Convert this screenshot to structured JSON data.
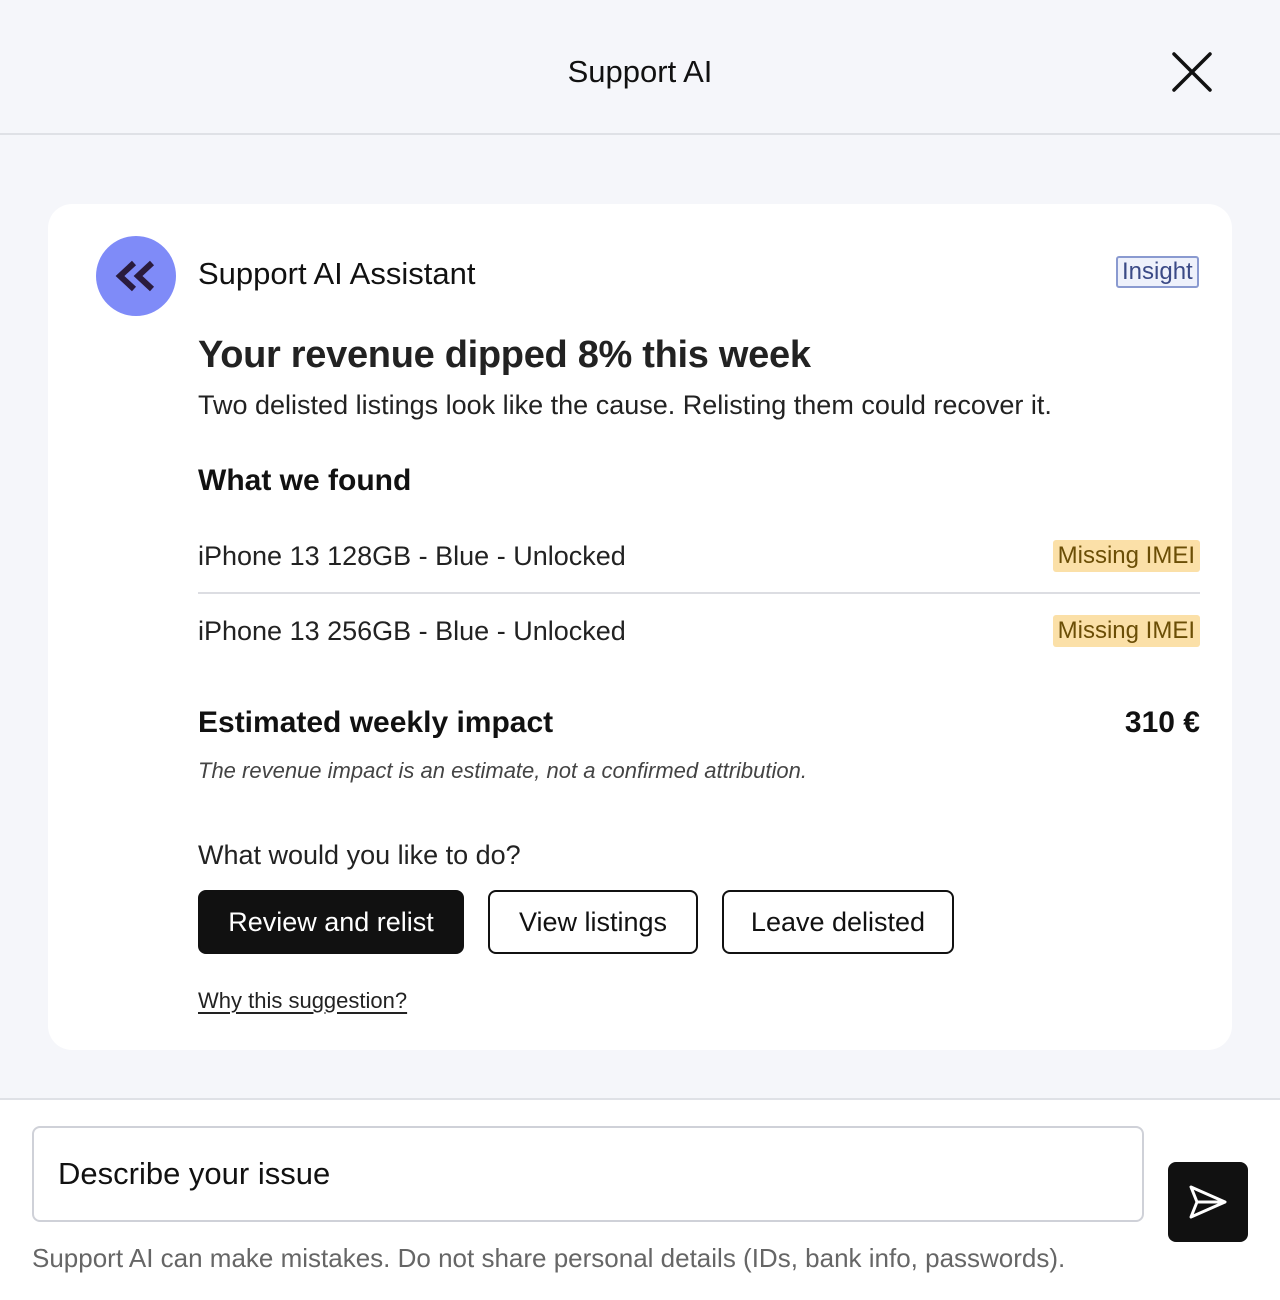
{
  "header": {
    "title": "Support AI",
    "close_icon": "close-icon"
  },
  "message": {
    "avatar_icon": "double-chevron-left-icon",
    "assistant_name": "Support AI Assistant",
    "badge": "Insight",
    "headline": "Your revenue dipped 8% this week",
    "subtext": "Two delisted listings look like the cause. Relisting them could recover it.",
    "findings_title": "What we found",
    "listings": [
      {
        "name": "iPhone 13 128GB - Blue - Unlocked",
        "status": "Missing IMEI"
      },
      {
        "name": "iPhone 13 256GB - Blue - Unlocked",
        "status": "Missing IMEI"
      }
    ],
    "impact_title": "Estimated weekly impact",
    "impact_value": "310 €",
    "impact_note": "The revenue impact is an estimate, not a confirmed attribution.",
    "question": "What would you like to do?",
    "actions": {
      "primary": "Review and relist",
      "view": "View listings",
      "leave": "Leave delisted"
    },
    "why_link": "Why this suggestion?"
  },
  "composer": {
    "placeholder": "Describe your issue",
    "send_icon": "send-icon",
    "disclaimer": "Support AI can make mistakes. Do not share personal details (IDs, bank info, passwords)."
  },
  "colors": {
    "avatar_bg": "#7f8bf8",
    "badge_bg": "#fbe0a8",
    "primary_button": "#111111",
    "page_bg": "#f5f6fa"
  }
}
